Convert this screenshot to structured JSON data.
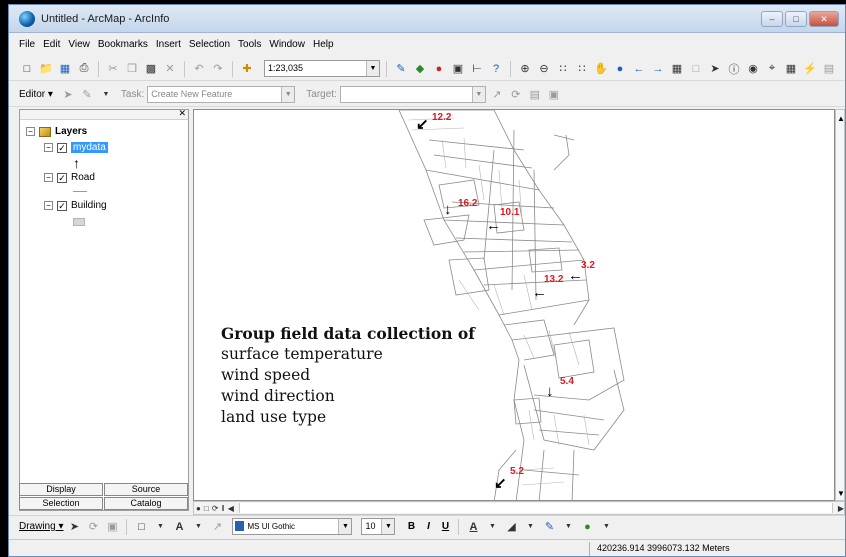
{
  "window": {
    "title": "Untitled - ArcMap - ArcInfo",
    "controls": [
      "–",
      "□",
      "✕"
    ]
  },
  "menu": [
    "File",
    "Edit",
    "View",
    "Bookmarks",
    "Insert",
    "Selection",
    "Tools",
    "Window",
    "Help"
  ],
  "toolbar": {
    "scale": "1:23,035",
    "editor_label": "Editor ▾",
    "task_label": "Task:",
    "task_value": "Create New Feature",
    "target_label": "Target:",
    "target_value": ""
  },
  "toc": {
    "root_label": "Layers",
    "layers": [
      {
        "name": "mydata",
        "checked": true,
        "selected": true
      },
      {
        "name": "Road",
        "checked": true,
        "selected": false
      },
      {
        "name": "Building",
        "checked": true,
        "selected": false
      }
    ],
    "tabs": [
      "Display",
      "Source",
      "Selection",
      "Catalog"
    ]
  },
  "map": {
    "overlay": {
      "title": "Group field data collection of",
      "lines": [
        "surface temperature",
        "wind speed",
        "wind direction",
        "land use type"
      ]
    },
    "wind_points": [
      {
        "label": "12.2",
        "arrow": "↙"
      },
      {
        "label": "16.2",
        "arrow": "↓"
      },
      {
        "label": "10.1",
        "arrow": "←"
      },
      {
        "label": "3.2",
        "arrow": "←"
      },
      {
        "label": "13.2",
        "arrow": "←"
      },
      {
        "label": "5.4",
        "arrow": "↓"
      },
      {
        "label": "5.2",
        "arrow": "↙"
      }
    ]
  },
  "drawing": {
    "label": "Drawing ▾",
    "font": "MS UI Gothic",
    "size": "10",
    "bold": "B",
    "italic": "I",
    "underline": "U"
  },
  "status": {
    "coords": "420236.914  3996073.132 Meters"
  },
  "colors": {
    "selection": "#3399ff",
    "wind_label": "#e0161e"
  }
}
